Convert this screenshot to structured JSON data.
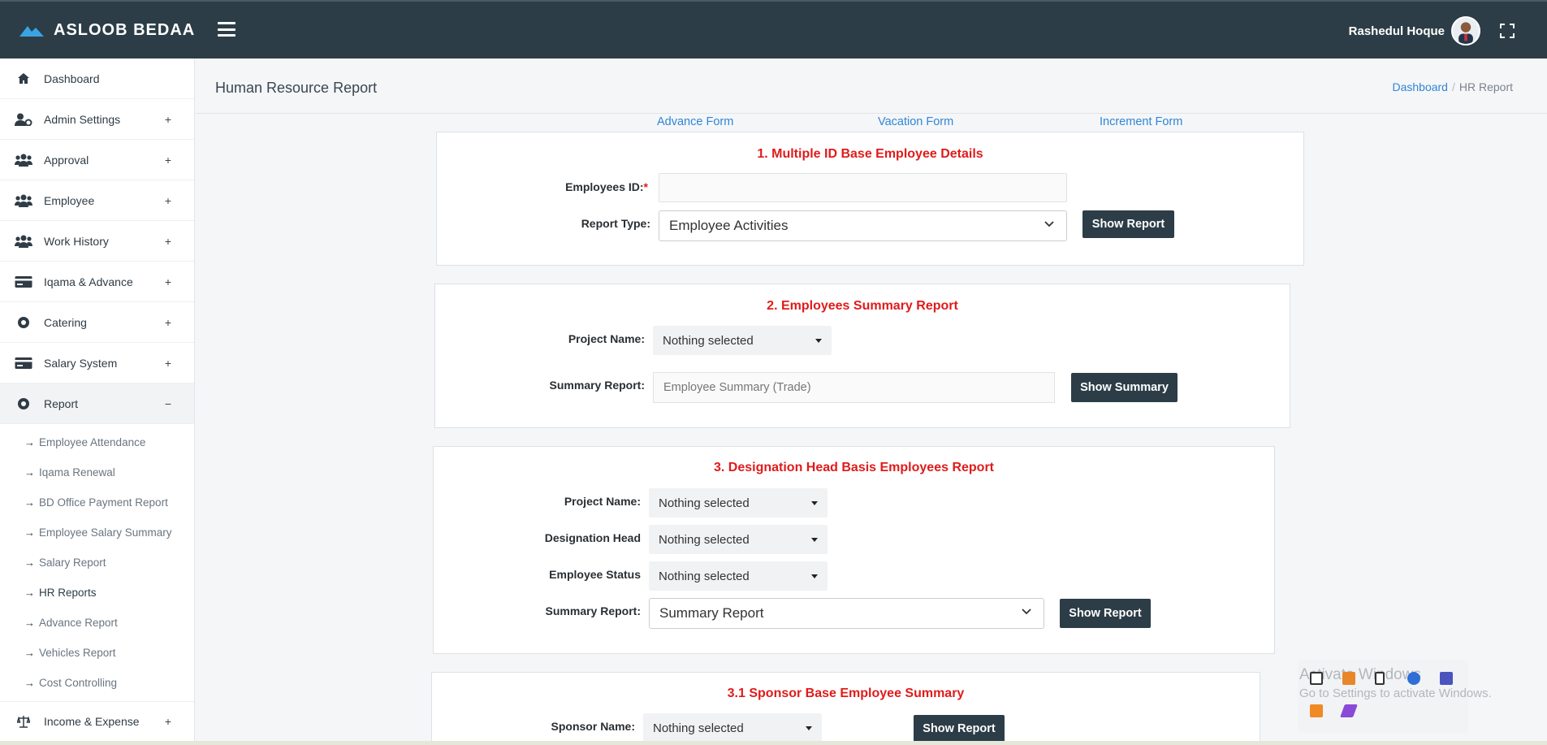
{
  "app": {
    "brand": "ASLOOB BEDAA",
    "user_name": "Rashedul Hoque"
  },
  "sidebar": {
    "items": [
      {
        "label": "Dashboard",
        "icon": "home-icon",
        "toggle": ""
      },
      {
        "label": "Admin Settings",
        "icon": "user-gear-icon",
        "toggle": "+"
      },
      {
        "label": "Approval",
        "icon": "users-icon",
        "toggle": "+"
      },
      {
        "label": "Employee",
        "icon": "users-icon",
        "toggle": "+"
      },
      {
        "label": "Work History",
        "icon": "users-icon",
        "toggle": "+"
      },
      {
        "label": "Iqama & Advance",
        "icon": "card-icon",
        "toggle": "+"
      },
      {
        "label": "Catering",
        "icon": "circle-dot-icon",
        "toggle": "+"
      },
      {
        "label": "Salary System",
        "icon": "card-icon",
        "toggle": "+"
      },
      {
        "label": "Report",
        "icon": "circle-dot-icon",
        "toggle": "−"
      }
    ],
    "report_sub": [
      "Employee Attendance",
      "Iqama Renewal",
      "BD Office Payment Report",
      "Employee Salary Summary",
      "Salary Report",
      "HR Reports",
      "Advance Report",
      "Vehicles Report",
      "Cost Controlling"
    ],
    "after": {
      "label": "Income & Expense",
      "icon": "scale-icon",
      "toggle": "+"
    }
  },
  "header": {
    "title": "Human Resource Report",
    "breadcrumb": {
      "home": "Dashboard",
      "separator": "/",
      "current": "HR Report"
    }
  },
  "form_links": [
    "Advance Form",
    "Vacation Form",
    "Increment Form"
  ],
  "sections": {
    "s1": {
      "title": "1. Multiple ID Base Employee Details",
      "employees_label": "Employees ID:",
      "required_mark": "*",
      "employees_value": "",
      "report_type_label": "Report Type:",
      "report_type_value": "Employee Activities",
      "button": "Show Report"
    },
    "s2": {
      "title": "2. Employees Summary Report",
      "project_label": "Project Name:",
      "project_value": "Nothing selected",
      "summary_label": "Summary Report:",
      "summary_value": "Employee Summary (Trade)",
      "button": "Show Summary"
    },
    "s3": {
      "title": "3. Designation Head Basis Employees Report",
      "project_label": "Project Name:",
      "project_value": "Nothing selected",
      "designation_label": "Designation Head",
      "designation_value": "Nothing selected",
      "status_label": "Employee Status",
      "status_value": "Nothing selected",
      "summary_label": "Summary Report:",
      "summary_value": "Summary Report",
      "button": "Show Report"
    },
    "s31": {
      "title": "3.1 Sponsor Base Employee Summary",
      "sponsor_label": "Sponsor Name:",
      "sponsor_value": "Nothing selected",
      "button": "Show Report"
    }
  },
  "windows_notice": {
    "title": "Activate Windows",
    "subtitle": "Go to Settings to activate Windows."
  },
  "colors": {
    "topbar": "#2c3d47",
    "section_title": "#e01b1b",
    "link": "#2f86d6",
    "button": "#2c3d47"
  }
}
